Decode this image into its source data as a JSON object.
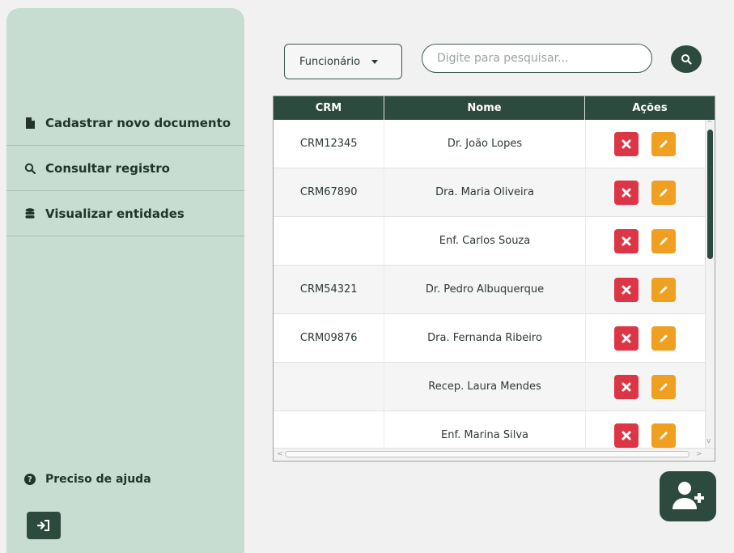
{
  "sidebar": {
    "items": [
      {
        "label": "Cadastrar novo documento",
        "icon": "document-icon"
      },
      {
        "label": "Consultar registro",
        "icon": "search-icon"
      },
      {
        "label": "Visualizar entidades",
        "icon": "database-icon"
      }
    ],
    "help_label": "Preciso de ajuda",
    "logout_icon": "logout-icon"
  },
  "filter": {
    "selected": "Funcionário",
    "search_placeholder": "Digite para pesquisar..."
  },
  "table": {
    "headers": [
      "CRM",
      "Nome",
      "Ações"
    ],
    "rows": [
      {
        "crm": "CRM12345",
        "nome": "Dr. João Lopes"
      },
      {
        "crm": "CRM67890",
        "nome": "Dra. Maria Oliveira"
      },
      {
        "crm": "",
        "nome": "Enf. Carlos Souza"
      },
      {
        "crm": "CRM54321",
        "nome": "Dr. Pedro Albuquerque"
      },
      {
        "crm": "CRM09876",
        "nome": "Dra. Fernanda Ribeiro"
      },
      {
        "crm": "",
        "nome": "Recep. Laura Mendes"
      },
      {
        "crm": "",
        "nome": "Enf. Marina Silva"
      }
    ]
  },
  "colors": {
    "primary": "#2c4a3e",
    "sidebar_bg": "#c7ddd2",
    "delete": "#dc3545",
    "edit": "#f0a020"
  },
  "fab_icon": "add-user-icon"
}
